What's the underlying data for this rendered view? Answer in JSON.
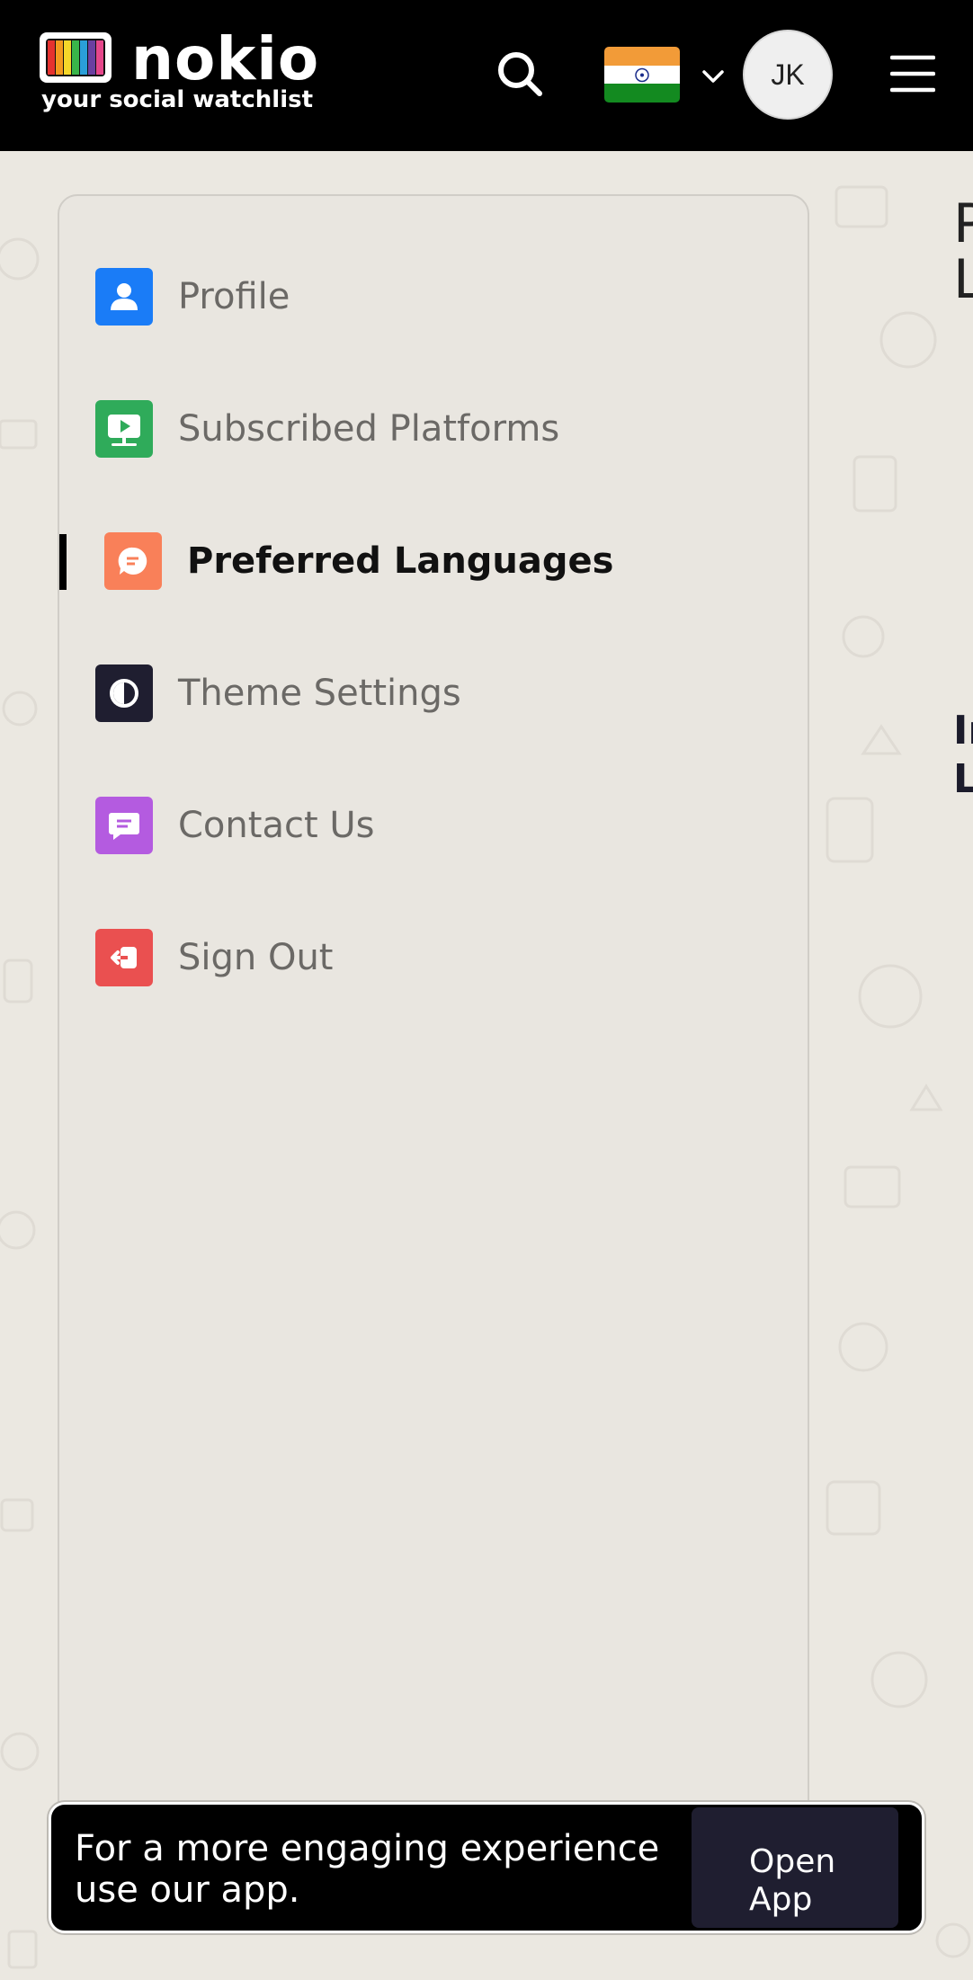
{
  "header": {
    "brand_name": "nokio",
    "brand_tagline": "your social watchlist",
    "avatar_initials": "JK",
    "flag": "India"
  },
  "sidebar": {
    "items": [
      {
        "label": "Profile",
        "icon": "profile-icon",
        "color": "#1a7cf7",
        "active": false
      },
      {
        "label": "Subscribed Platforms",
        "icon": "tv-play-icon",
        "color": "#2fab5a",
        "active": false
      },
      {
        "label": "Preferred Languages",
        "icon": "chat-bubble-icon",
        "color": "#f98059",
        "active": true
      },
      {
        "label": "Theme Settings",
        "icon": "theme-contrast-icon",
        "color": "#1f1e30",
        "active": false
      },
      {
        "label": "Contact Us",
        "icon": "message-icon",
        "color": "#b45be0",
        "active": false
      },
      {
        "label": "Sign Out",
        "icon": "sign-out-icon",
        "color": "#ea5050",
        "active": false
      }
    ]
  },
  "main": {
    "title_partial": "P\nL",
    "subtitle_partial": "In\nL"
  },
  "banner": {
    "text": "For a more engaging experience use our app.",
    "button_label": "Open App"
  },
  "colors": {
    "topbar": "#000000",
    "page_background": "#ebe8e1",
    "active_indicator": "#000000",
    "open_app_button": "#1f1e30"
  }
}
